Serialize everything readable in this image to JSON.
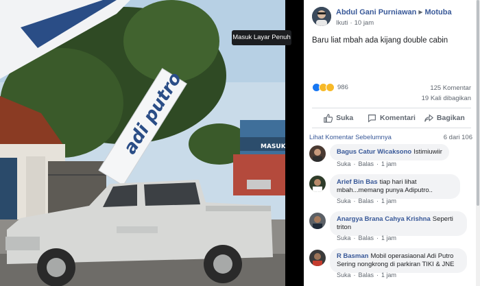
{
  "viewer": {
    "tooltip": "Masuk Layar Penuh",
    "banner_text": "adi putro",
    "sign_text": "MASUK"
  },
  "post": {
    "author": "Abdul Gani Purniawan",
    "group": "Motuba",
    "follow_label": "Ikuti",
    "time": "10 jam",
    "text": "Baru liat mbah ada kijang double cabin",
    "reaction_count": "986",
    "comment_count": "125 Komentar",
    "share_count": "19 Kali dibagikan"
  },
  "actions": {
    "like": "Suka",
    "comment": "Komentari",
    "share": "Bagikan"
  },
  "comments_header": {
    "prev_link": "Lihat Komentar Sebelumnya",
    "count": "6 dari 106"
  },
  "comment_actions": {
    "like": "Suka",
    "reply": "Balas"
  },
  "comments": [
    {
      "name": "Bagus Catur Wicaksono",
      "text": "Istimiuwiir",
      "time": "1 jam"
    },
    {
      "name": "Arief Bin Bas",
      "text_line1": "tiap hari lihat",
      "text_line2": "mbah...memang punya Adiputro..",
      "time": "1 jam"
    },
    {
      "name": "Anargya Brana Cahya Krishna",
      "text_line1": "Seperti",
      "text_line2": "triton",
      "time": "1 jam"
    },
    {
      "name": "R Basman",
      "text_line1": "Mobil operasiaonal Adi Putro",
      "text_line2": "Sering nongkrong di parkiran TIKI & JNE",
      "time": "1 jam"
    }
  ],
  "colors": {
    "link": "#385898",
    "like_blue": "#1877f2",
    "bubble": "#f2f3f5"
  }
}
